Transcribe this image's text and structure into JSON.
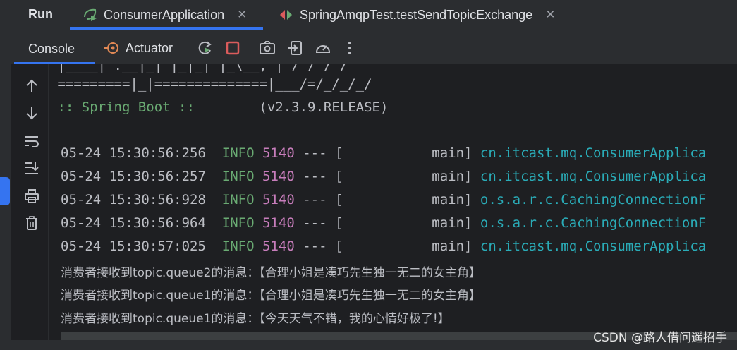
{
  "run_tabs": {
    "panel_title": "Run",
    "tabs": [
      {
        "label": "ConsumerApplication",
        "icon": "spring-boot-run-icon"
      },
      {
        "label": "SpringAmqpTest.testSendTopicExchange",
        "icon": "junit-test-icon"
      }
    ]
  },
  "toolbar": {
    "console_tab": "Console",
    "actuator_tab": "Actuator"
  },
  "console": {
    "banner_top": " =========|_|==============|___/=/_/_/_/",
    "spring_boot": " :: Spring Boot :: ",
    "version": "       (v2.3.9.RELEASE)",
    "logs": [
      {
        "time": "05-24 15:30:56:256",
        "level": "INFO",
        "pid": "5140",
        "sep": " --- [",
        "thread": "           main]",
        "logger": "cn.itcast.mq.ConsumerApplica"
      },
      {
        "time": "05-24 15:30:56:257",
        "level": "INFO",
        "pid": "5140",
        "sep": " --- [",
        "thread": "           main]",
        "logger": "cn.itcast.mq.ConsumerApplica"
      },
      {
        "time": "05-24 15:30:56:928",
        "level": "INFO",
        "pid": "5140",
        "sep": " --- [",
        "thread": "           main]",
        "logger": "o.s.a.r.c.CachingConnectionF"
      },
      {
        "time": "05-24 15:30:56:964",
        "level": "INFO",
        "pid": "5140",
        "sep": " --- [",
        "thread": "           main]",
        "logger": "o.s.a.r.c.CachingConnectionF"
      },
      {
        "time": "05-24 15:30:57:025",
        "level": "INFO",
        "pid": "5140",
        "sep": " --- [",
        "thread": "           main]",
        "logger": "cn.itcast.mq.ConsumerApplica"
      }
    ],
    "messages": [
      "消费者接收到topic.queue2的消息：【合理小姐是凑巧先生独一无二的女主角】",
      "消费者接收到topic.queue1的消息：【合理小姐是凑巧先生独一无二的女主角】",
      "消费者接收到topic.queue1的消息：【今天天气不错，我的心情好极了!】"
    ]
  },
  "watermark": "CSDN @路人借问遥招手",
  "colors": {
    "accent": "#3574f0",
    "info": "#6aab73",
    "pid": "#c77dbb",
    "logger": "#2aacb8",
    "stop": "#db5c5c"
  }
}
